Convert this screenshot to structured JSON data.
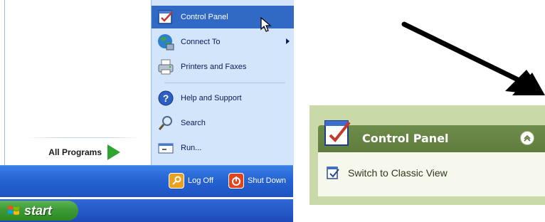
{
  "start_menu": {
    "all_programs": "All Programs",
    "right_items": [
      {
        "label": "Control Panel",
        "icon": "control-panel-icon",
        "selected": true
      },
      {
        "label": "Connect To",
        "icon": "globe-network-icon",
        "has_submenu": true
      },
      {
        "label": "Printers and Faxes",
        "icon": "printer-icon"
      },
      {
        "label": "Help and Support",
        "icon": "help-icon"
      },
      {
        "label": "Search",
        "icon": "search-icon"
      },
      {
        "label": "Run...",
        "icon": "run-icon"
      }
    ],
    "log_off": "Log Off",
    "shut_down": "Shut Down"
  },
  "taskbar": {
    "start_label": "start"
  },
  "control_panel_box": {
    "title": "Control Panel",
    "link": "Switch to Classic View"
  },
  "colors": {
    "selection": "#316ac5",
    "right_pane": "#d3e5fa",
    "start_button": "#3e9a37",
    "cp_header": "#5f7c3e",
    "cp_frame": "#c9d9a8"
  }
}
